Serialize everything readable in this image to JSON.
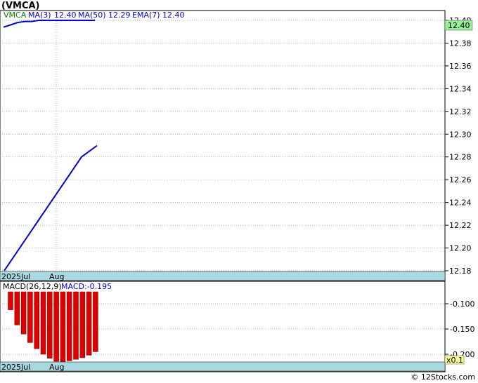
{
  "header": {
    "title": "(VMCA)",
    "legend": {
      "symbol": "VMCA",
      "ma3_label": "MA(3)",
      "ma3_value": "12.40",
      "ma50_label": "MA(50)",
      "ma50_value": "12.29",
      "ema7_label": "EMA(7)",
      "ema7_value": "12.40"
    }
  },
  "price_panel": {
    "current_price_label": "12.40",
    "x_labels": [
      "2025Jul",
      "Aug"
    ]
  },
  "macd_panel": {
    "label": "MACD(26,12,9)",
    "value_text": "MACD:-0.195",
    "x_labels": [
      "2025Jul",
      "Aug"
    ],
    "scale_badge": "x0.1"
  },
  "watermark": "© 12Stocks.com",
  "colors": {
    "ma_line": "#0000cc",
    "macd_bar": "#e00000",
    "axis_band": "#a8d8e0",
    "price_badge": "#99ee99",
    "scale_badge": "#ffff99",
    "legend_symbol": "#008000"
  },
  "chart_data": [
    {
      "type": "line",
      "name": "price",
      "ylim": [
        12.17,
        12.41
      ],
      "yticks": [
        12.18,
        12.2,
        12.22,
        12.24,
        12.26,
        12.28,
        12.3,
        12.32,
        12.34,
        12.36,
        12.38,
        12.4
      ],
      "x_labels": [
        "2025Jul",
        "Aug"
      ],
      "series": [
        {
          "name": "MA(3)",
          "values": [
            12.394,
            12.396,
            12.398,
            12.399,
            12.399,
            12.4,
            12.4,
            12.4,
            12.4,
            12.4,
            12.4,
            12.4,
            12.4,
            12.4
          ]
        },
        {
          "name": "MA(50)",
          "values": [
            12.18,
            12.2,
            12.22,
            12.24,
            12.26,
            12.28,
            12.29
          ]
        }
      ],
      "grid": true
    },
    {
      "type": "bar",
      "name": "macd",
      "ylim": [
        -0.21,
        -0.082
      ],
      "yticks": [
        -0.1,
        -0.15,
        -0.2
      ],
      "values": [
        -0.112,
        -0.142,
        -0.16,
        -0.177,
        -0.189,
        -0.2,
        -0.208,
        -0.214,
        -0.215,
        -0.213,
        -0.21,
        -0.207,
        -0.202,
        -0.195
      ],
      "grid": true
    }
  ]
}
